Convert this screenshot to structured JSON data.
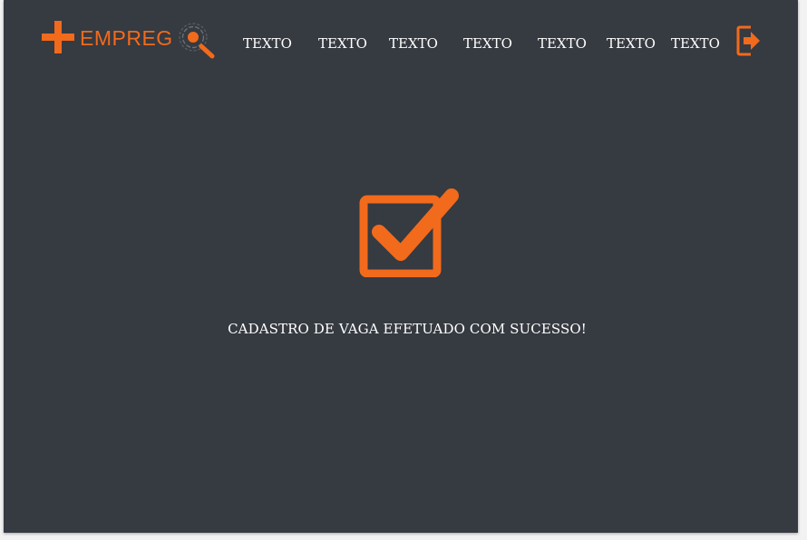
{
  "brand": {
    "name": "EMPREG",
    "accent_color": "#f26a1b",
    "background_color": "#363a41",
    "icons": [
      "plus-icon",
      "magnifier-icon"
    ]
  },
  "nav": {
    "items": [
      "TEXTO",
      "TEXTO",
      "TEXTO",
      "TEXTO",
      "TEXTO",
      "TEXTO",
      "TEXTO"
    ],
    "logout_icon": "logout-icon"
  },
  "main": {
    "status_icon": "checked-checkbox-icon",
    "message": "CADASTRO DE VAGA EFETUADO COM SUCESSO!"
  }
}
